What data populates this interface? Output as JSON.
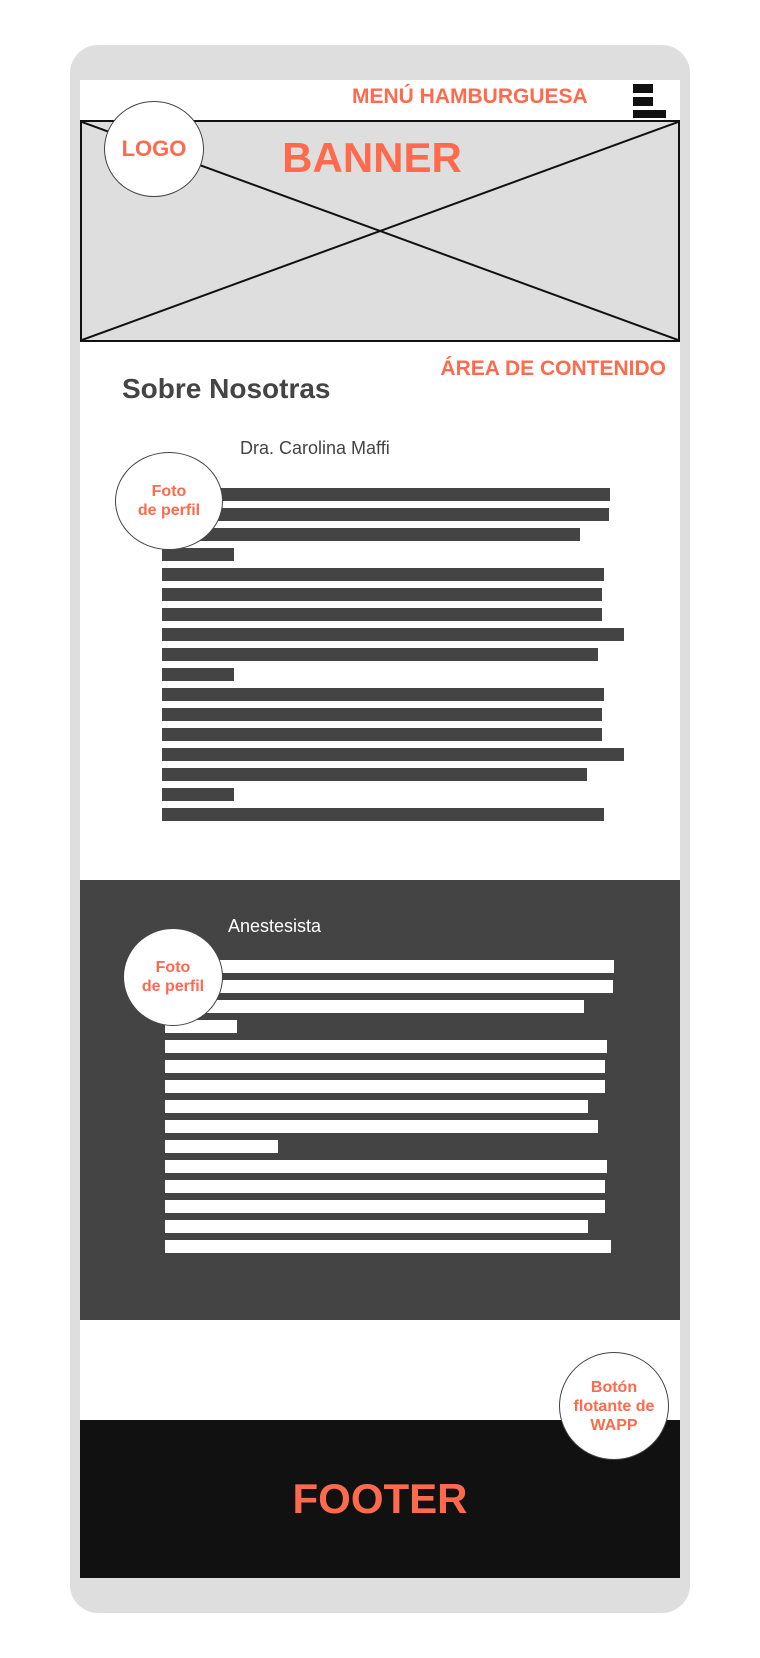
{
  "header": {
    "menu_label": "MENÚ HAMBURGUESA",
    "hamburger_icon": "hamburger-icon"
  },
  "banner": {
    "label": "BANNER"
  },
  "logo": {
    "label": "LOGO"
  },
  "content": {
    "area_label": "ÁREA DE CONTENIDO",
    "section_title": "Sobre Nosotras"
  },
  "profiles": [
    {
      "name": "Dra. Carolina Maffi",
      "photo_label_line1": "Foto",
      "photo_label_line2": "de perfil"
    },
    {
      "name": "Anestesista",
      "photo_label_line1": "Foto",
      "photo_label_line2": "de perfil"
    }
  ],
  "whatsapp_button": {
    "line1": "Botón",
    "line2": "flotante de",
    "line3": "WAPP"
  },
  "footer": {
    "label": "FOOTER"
  },
  "colors": {
    "accent": "#ff6a4d",
    "dark_gray": "#444444",
    "light_gray": "#dedede",
    "black": "#111111"
  }
}
